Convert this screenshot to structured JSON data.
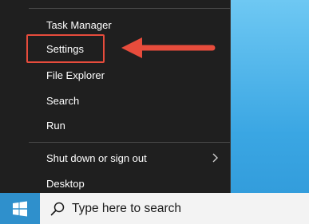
{
  "menu": {
    "items": [
      {
        "label": "Task Manager"
      },
      {
        "label": "Settings"
      },
      {
        "label": "File Explorer"
      },
      {
        "label": "Search"
      },
      {
        "label": "Run"
      },
      {
        "label": "Shut down or sign out"
      },
      {
        "label": "Desktop"
      }
    ]
  },
  "taskbar": {
    "search_placeholder": "Type here to search"
  },
  "colors": {
    "menu_bg": "#1f1f1f",
    "highlight": "#e74c3c",
    "taskbar": "#3aa3de"
  }
}
